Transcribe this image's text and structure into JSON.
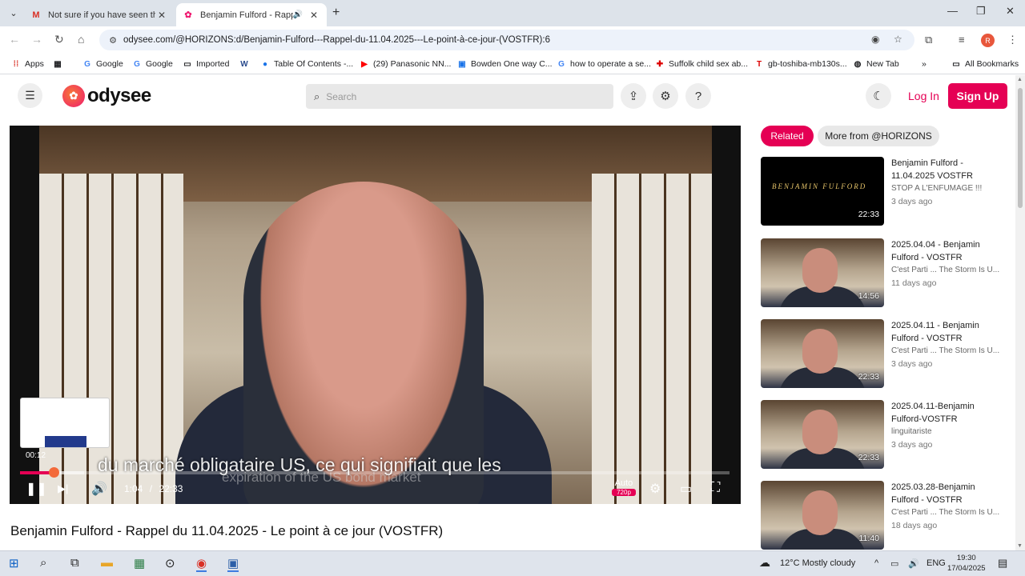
{
  "browser": {
    "tabs": [
      {
        "title": "Not sure if you have seen this v",
        "icon": "gmail-icon"
      },
      {
        "title": "Benjamin Fulford - Rappel c",
        "icon": "odysee-icon",
        "audio": true
      }
    ],
    "url": "odysee.com/@HORIZONS:d/Benjamin-Fulford---Rappel-du-11.04.2025---Le-point-à-ce-jour-(VOSTFR):6",
    "profile_initial": "R",
    "bookmarks": [
      {
        "label": "Apps"
      },
      {
        "label": "Google"
      },
      {
        "label": "Google"
      },
      {
        "label": "Imported"
      },
      {
        "label": "Table Of Contents -..."
      },
      {
        "label": "(29) Panasonic NN..."
      },
      {
        "label": "Bowden One way C..."
      },
      {
        "label": "how to operate a se..."
      },
      {
        "label": "Suffolk child sex ab..."
      },
      {
        "label": "gb-toshiba-mb130s..."
      },
      {
        "label": "New Tab"
      }
    ],
    "all_bookmarks": "All Bookmarks"
  },
  "header": {
    "logo_text": "odysee",
    "search_placeholder": "Search",
    "login": "Log In",
    "signup": "Sign Up"
  },
  "player": {
    "subtitle_main": "du marché obligataire US, ce qui signifiait que les",
    "subtitle_under": "expiration of the US bond market",
    "preview_time": "00:12",
    "current_time": "1:04",
    "separator": "/",
    "duration": "22:33",
    "quality_auto": "Auto",
    "quality": "720p",
    "progress": 0.047,
    "buffered": 0.09
  },
  "video_title": "Benjamin Fulford - Rappel du 11.04.2025 - Le point à ce jour (VOSTFR)",
  "sidebar": {
    "chip_related": "Related",
    "chip_more": "More from @HORIZONS",
    "items": [
      {
        "title": "Benjamin Fulford - 11.04.2025 VOSTFR",
        "channel": "STOP A L'ENFUMAGE !!!",
        "age": "3 days ago",
        "duration": "22:33",
        "thumb_text": "BENJAMIN FULFORD",
        "dark": true
      },
      {
        "title": "2025.04.04 - Benjamin Fulford - VOSTFR",
        "channel": "C'est Parti ... The Storm Is U...",
        "age": "11 days ago",
        "duration": "14:56"
      },
      {
        "title": "2025.04.11 - Benjamin Fulford - VOSTFR",
        "channel": "C'est Parti ... The Storm Is U...",
        "age": "3 days ago",
        "duration": "22:33"
      },
      {
        "title": "2025.04.11-Benjamin Fulford-VOSTFR",
        "channel": "linguitariste",
        "age": "3 days ago",
        "duration": "22:33"
      },
      {
        "title": "2025.03.28-Benjamin Fulford - VOSTFR",
        "channel": "C'est Parti ... The Storm Is U...",
        "age": "18 days ago",
        "duration": "11:40"
      }
    ]
  },
  "taskbar": {
    "weather": "12°C  Mostly cloudy",
    "lang": "ENG",
    "time": "19:30",
    "date": "17/04/2025"
  },
  "colors": {
    "accent": "#e50054",
    "chrome_bg": "#dde3ea"
  }
}
